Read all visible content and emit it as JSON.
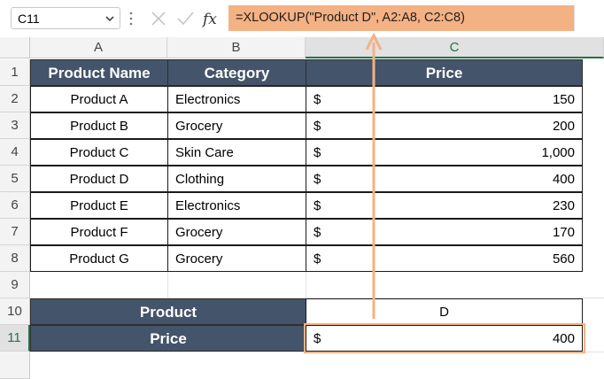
{
  "name_box": {
    "value": "C11"
  },
  "formula_bar": {
    "formula": "=XLOOKUP(\"Product D\", A2:A8, C2:C8)"
  },
  "columns": [
    "A",
    "B",
    "C"
  ],
  "rows": [
    "1",
    "2",
    "3",
    "4",
    "5",
    "6",
    "7",
    "8",
    "9",
    "10",
    "11"
  ],
  "table": {
    "headers": [
      "Product Name",
      "Category",
      "Price"
    ],
    "rows": [
      {
        "product": "Product A",
        "category": "Electronics",
        "currency": "$",
        "price": "150"
      },
      {
        "product": "Product B",
        "category": "Grocery",
        "currency": "$",
        "price": "200"
      },
      {
        "product": "Product C",
        "category": "Skin Care",
        "currency": "$",
        "price": "1,000"
      },
      {
        "product": "Product D",
        "category": "Clothing",
        "currency": "$",
        "price": "400"
      },
      {
        "product": "Product E",
        "category": "Electronics",
        "currency": "$",
        "price": "230"
      },
      {
        "product": "Product F",
        "category": "Grocery",
        "currency": "$",
        "price": "170"
      },
      {
        "product": "Product G",
        "category": "Grocery",
        "currency": "$",
        "price": "560"
      }
    ]
  },
  "lookup": {
    "product_label": "Product",
    "product_value": "D",
    "price_label": "Price",
    "price_currency": "$",
    "price_value": "400"
  },
  "colors": {
    "header_fill": "#44546a",
    "highlight": "#f4b183",
    "excel_green": "#217346"
  }
}
